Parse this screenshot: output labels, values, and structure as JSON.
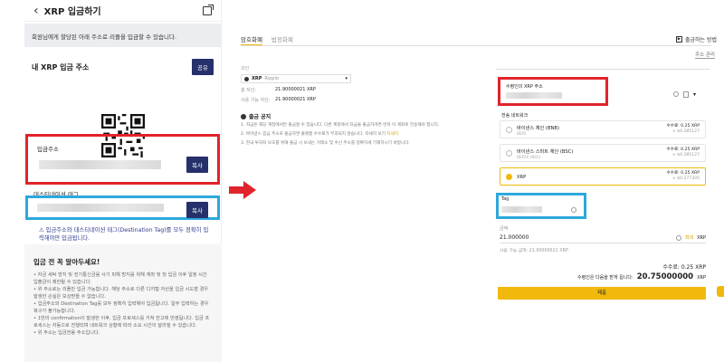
{
  "left": {
    "header": {
      "title": "XRP 입금하기"
    },
    "notice": "회원님에게 할당된 아래 주소로 리플을 입금할 수 있습니다.",
    "address_section_label": "내 XRP 입금 주소",
    "share_button": "공유",
    "deposit_address_label": "입금주소",
    "copy_button_1": "복사",
    "destination_tag_label": "데스티네이션 태그",
    "copy_button_2": "복사",
    "warning": "입금주소와 데스티네이션 태그(Destination Tag)를 모두 정확히 입력해야만 입금됩니다.",
    "before_deposit_heading": "입금 전 꼭 알아두세요!",
    "before_deposit_items": [
      "• 자금 세탁 방지 및 전기통신금융 사기 피해 방지를 위해 계좌 및 첫 입금 이후 일정 시간 입출금이 제한될 수 있습니다.",
      "• 위 주소로는 리플만 입금 가능합니다. 해당 주소로 다른 디지털 자산을 입금 시도할 경우 발생한 손실은 보상받을 수 없습니다.",
      "• 입금주소와 Destination Tag를 모두 정확히 입력해야 입금됩니다. 일부 입력하는 경우 복구가 불가능합니다.",
      "• 1번의 confirmation이 발생한 이후, 입금 프로세스를 거쳐 잔고에 반영됩니다. 입금 프로세스는 자동으로 진행되며 네트워크 상황에 따라 소요 시간이 달라질 수 있습니다.",
      "• 위 주소는 입금전용 주소입니다."
    ]
  },
  "right": {
    "tabs": [
      "암호화폐",
      "법정화폐"
    ],
    "top_link": "출금하는 방법",
    "address_mgmt": "주소 관리",
    "coin_label": "코인",
    "coin_name": "XRP",
    "coin_sub": "Ripple",
    "balance_rows": [
      {
        "k": "총 자산:",
        "v": "21.90000021 XRP"
      },
      {
        "k": "사용 가능 자산:",
        "v": "21.90000021 XRP"
      }
    ],
    "notice_heading": "출금 공지",
    "notice_items": [
      "1. 자금은 해당 계정에서만 출금할 수 있습니다. 다른 계정에서 자금을 출금하려면 먼저 이 계좌로 전송해야 합니다.",
      "2. 바이낸스 입금 주소로 출금하면 플랫폼 수수료가 부과되지 않습니다. 자세히 보기",
      "3. 한국 투자자 보호를 위해 출금 시 보내는 거래소 및 수신 주소를 정확하게 기재하시기 바랍니다."
    ],
    "notice_link": "자세히",
    "form": {
      "recipient_label": "수령인의 XRP 주소",
      "network_label": "전송 네트워크",
      "networks": [
        {
          "name": "바이낸스 체인 (BNB)",
          "sub": "BEP2",
          "fee": "수수료: 0.25 XRP",
          "fee_sub": "≈ $0.285127"
        },
        {
          "name": "바이낸스 스마트 체인 (BSC)",
          "sub": "BEP20 (BSC)",
          "fee": "수수료: 0.25 XRP",
          "fee_sub": "≈ $0.285127"
        },
        {
          "name": "XRP",
          "sub": "",
          "fee": "수수료: 0.25 XRP",
          "fee_sub": "≈ $0.277305"
        }
      ],
      "tag_label": "Tag",
      "amount_label": "금액",
      "amount_value": "21.000000",
      "max_label": "최대",
      "amount_unit": "XRP",
      "available": "사용 가능 금액: 21.90000021 XRP",
      "fee_line": "수수료: 0.25 XRP",
      "receive_label": "수령인은 다음을 받게 됩니다:",
      "receive_amount": "20.75000000",
      "receive_unit": "XRP",
      "submit": "제출"
    }
  },
  "colors": {
    "red_highlight": "#e0242b",
    "blue_highlight": "#2ba8dc",
    "navy_button": "#26306b",
    "binance_yellow": "#f0b90b"
  }
}
